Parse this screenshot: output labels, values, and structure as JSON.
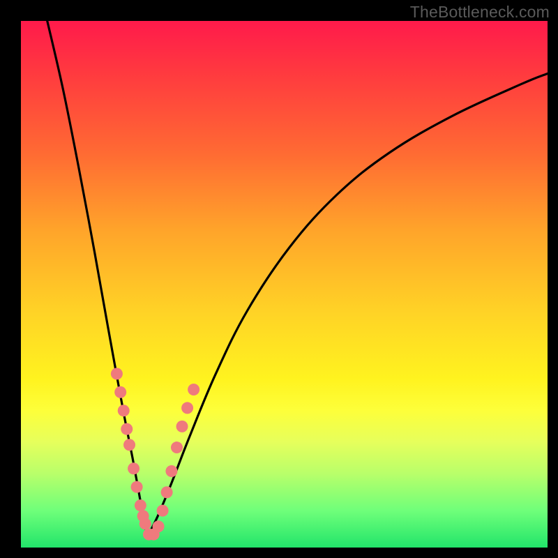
{
  "watermark": "TheBottleneck.com",
  "colors": {
    "frame": "#000000",
    "curve": "#000000",
    "marker_fill": "#ef7a7d",
    "marker_stroke": "#ef7a7d"
  },
  "chart_data": {
    "type": "line",
    "title": "",
    "xlabel": "",
    "ylabel": "",
    "xlim": [
      0,
      1
    ],
    "ylim": [
      0,
      1
    ],
    "note": "V-shaped bottleneck curve; axes are unlabeled and unitless. x and y are normalized fractions of the plotting area (0,0 = bottom-left). Curve is two smooth branches meeting near a minimum around x≈0.24, y≈0.02.",
    "series": [
      {
        "name": "left-branch",
        "x": [
          0.05,
          0.08,
          0.11,
          0.14,
          0.165,
          0.185,
          0.2,
          0.212,
          0.223,
          0.232,
          0.24
        ],
        "y": [
          1.0,
          0.87,
          0.72,
          0.56,
          0.42,
          0.31,
          0.23,
          0.17,
          0.11,
          0.06,
          0.02
        ]
      },
      {
        "name": "right-branch",
        "x": [
          0.24,
          0.26,
          0.285,
          0.32,
          0.37,
          0.43,
          0.51,
          0.6,
          0.7,
          0.82,
          0.95,
          1.0
        ],
        "y": [
          0.02,
          0.06,
          0.12,
          0.21,
          0.33,
          0.45,
          0.57,
          0.67,
          0.75,
          0.82,
          0.88,
          0.9
        ]
      }
    ],
    "markers": {
      "name": "pink-dots",
      "note": "clustered near the dip of the V on both branches",
      "points": [
        {
          "x": 0.182,
          "y": 0.33
        },
        {
          "x": 0.189,
          "y": 0.295
        },
        {
          "x": 0.195,
          "y": 0.26
        },
        {
          "x": 0.201,
          "y": 0.225
        },
        {
          "x": 0.206,
          "y": 0.195
        },
        {
          "x": 0.214,
          "y": 0.15
        },
        {
          "x": 0.22,
          "y": 0.115
        },
        {
          "x": 0.227,
          "y": 0.08
        },
        {
          "x": 0.232,
          "y": 0.06
        },
        {
          "x": 0.236,
          "y": 0.045
        },
        {
          "x": 0.243,
          "y": 0.025
        },
        {
          "x": 0.252,
          "y": 0.025
        },
        {
          "x": 0.261,
          "y": 0.04
        },
        {
          "x": 0.269,
          "y": 0.07
        },
        {
          "x": 0.277,
          "y": 0.105
        },
        {
          "x": 0.286,
          "y": 0.145
        },
        {
          "x": 0.296,
          "y": 0.19
        },
        {
          "x": 0.306,
          "y": 0.23
        },
        {
          "x": 0.316,
          "y": 0.265
        },
        {
          "x": 0.328,
          "y": 0.3
        }
      ]
    }
  }
}
